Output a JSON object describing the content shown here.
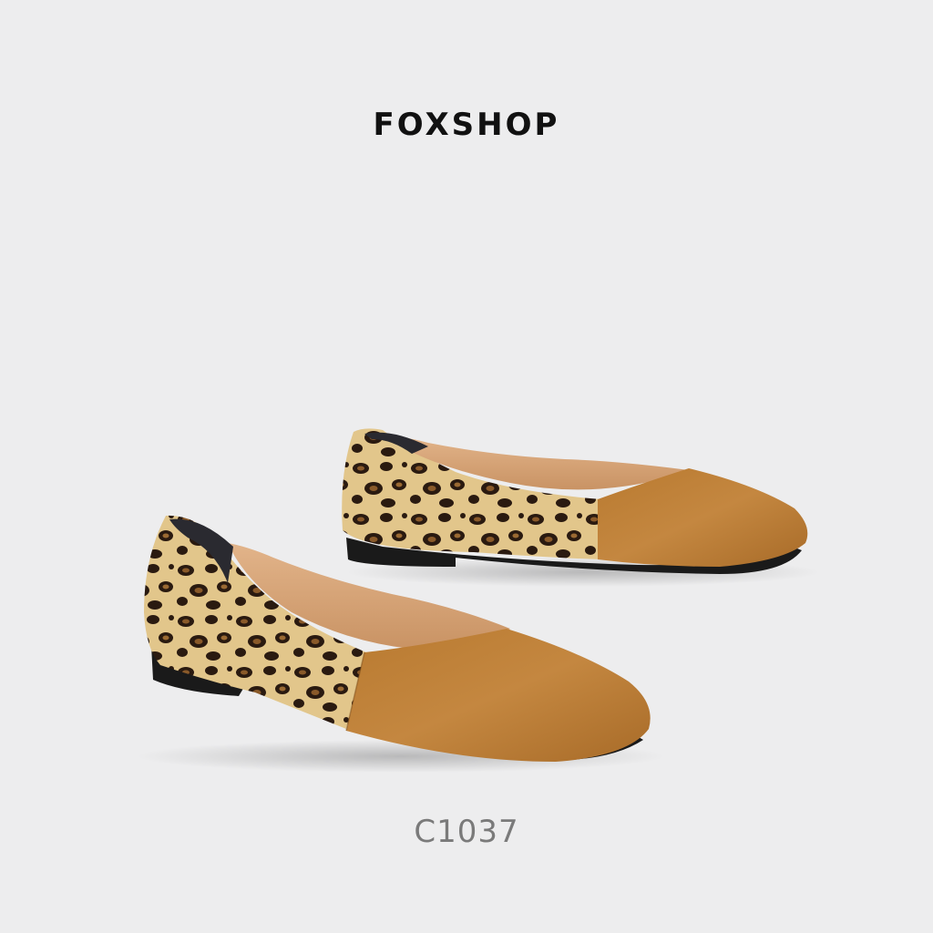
{
  "brand": {
    "name": "FOXSHOP"
  },
  "product": {
    "code": "C1037",
    "image_subject": "pair-of-flat-shoes",
    "colors": {
      "background": "#ededee",
      "suede_toe": "#c2843a",
      "leopard_base": "#d9b877",
      "leopard_spot": "#2a1a10",
      "lining": "#d9a97a",
      "sole": "#1a1a1a"
    }
  }
}
